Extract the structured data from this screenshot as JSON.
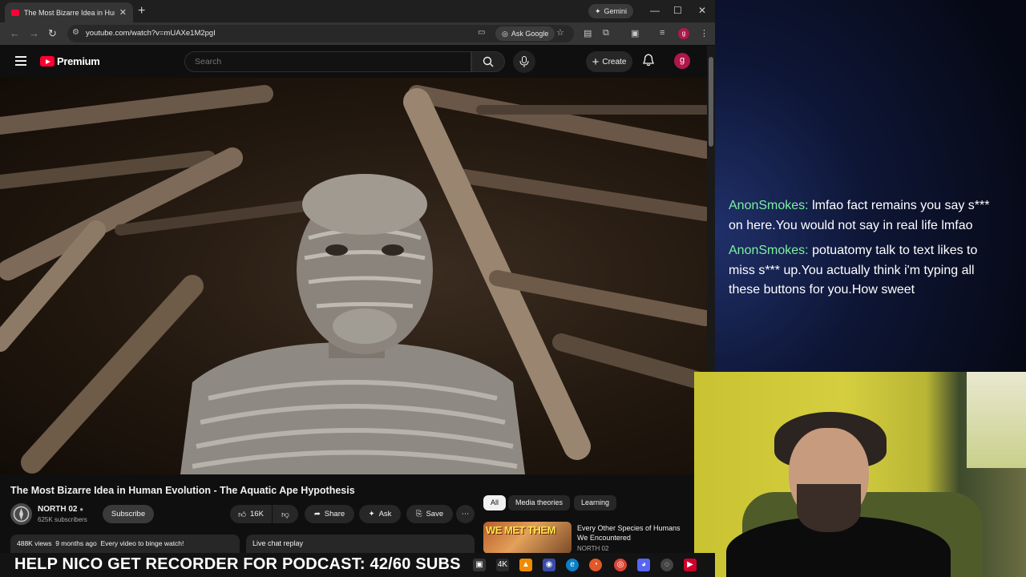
{
  "browser": {
    "tab_title": "The Most Bizarre Idea in Huma",
    "gemini_label": "Gemini",
    "url": "youtube.com/watch?v=mUAXe1M2pgI",
    "ask_google_label": "Ask Google",
    "profile_initial": "g"
  },
  "youtube": {
    "brand": "Premium",
    "search_placeholder": "Search",
    "create_label": "Create",
    "avatar_initial": "g"
  },
  "video": {
    "title": "The Most Bizarre Idea in Human Evolution - The Aquatic Ape Hypothesis",
    "channel_name": "NORTH 02",
    "subscribers": "625K subscribers",
    "subscribe_label": "Subscribe",
    "likes": "16K",
    "share_label": "Share",
    "ask_label": "Ask",
    "save_label": "Save",
    "views": "488K views",
    "posted": "9 months ago",
    "description_snippet": "Every video to binge watch!",
    "live_chat_replay": "Live chat replay"
  },
  "recommendations": {
    "chips": [
      "All",
      "Media theories",
      "Learning"
    ],
    "active_chip": "All",
    "items": [
      {
        "thumb_text": "WE MET THEM",
        "title": "Every Other Species of Humans We Encountered",
        "channel": "NORTH 02"
      }
    ]
  },
  "chat": [
    {
      "user": "AnonSmokes:",
      "text": "lmfao fact remains you say s*** on here.You would not say in real life lmfao"
    },
    {
      "user": "AnonSmokes:",
      "text": "potuatomy talk to text likes to miss s*** up.You actually think i'm typing all these buttons for you.How sweet"
    }
  ],
  "banner": {
    "text": "HELP NICO GET RECORDER FOR PODCAST: 42/60 SUBS"
  },
  "colors": {
    "youtube_red": "#ff0033",
    "chat_username": "#7cf0a0"
  }
}
